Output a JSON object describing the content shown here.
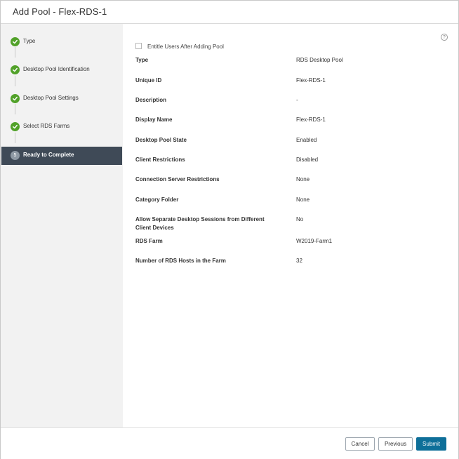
{
  "dialog": {
    "title": "Add Pool - Flex-RDS-1"
  },
  "wizard": {
    "steps": [
      {
        "label": "Type",
        "status": "complete"
      },
      {
        "label": "Desktop Pool Identification",
        "status": "complete"
      },
      {
        "label": "Desktop Pool Settings",
        "status": "complete"
      },
      {
        "label": "Select RDS Farms",
        "status": "complete"
      },
      {
        "number": "5",
        "label": "Ready to Complete",
        "status": "active"
      }
    ]
  },
  "summary": {
    "help_glyph": "?",
    "entitle_label": "Entitle Users After Adding Pool",
    "entitle_checked": false,
    "rows": [
      {
        "key": "Type",
        "value": "RDS Desktop Pool"
      },
      {
        "key": "Unique ID",
        "value": "Flex-RDS-1"
      },
      {
        "key": "Description",
        "value": "-"
      },
      {
        "key": "Display Name",
        "value": "Flex-RDS-1"
      },
      {
        "key": "Desktop Pool State",
        "value": "Enabled"
      },
      {
        "key": "Client Restrictions",
        "value": "Disabled"
      },
      {
        "key": "Connection Server Restrictions",
        "value": "None"
      },
      {
        "key": "Category Folder",
        "value": "None"
      },
      {
        "key": "Allow Separate Desktop Sessions from Different Client Devices",
        "value": "No"
      },
      {
        "key": "RDS Farm",
        "value": "W2019-Farm1"
      },
      {
        "key": "Number of RDS Hosts in the Farm",
        "value": "32"
      }
    ]
  },
  "footer": {
    "cancel_label": "Cancel",
    "previous_label": "Previous",
    "submit_label": "Submit"
  },
  "colors": {
    "step_complete": "#51a129",
    "step_active_bg": "#3f4a57",
    "primary_button": "#0e6f99"
  }
}
